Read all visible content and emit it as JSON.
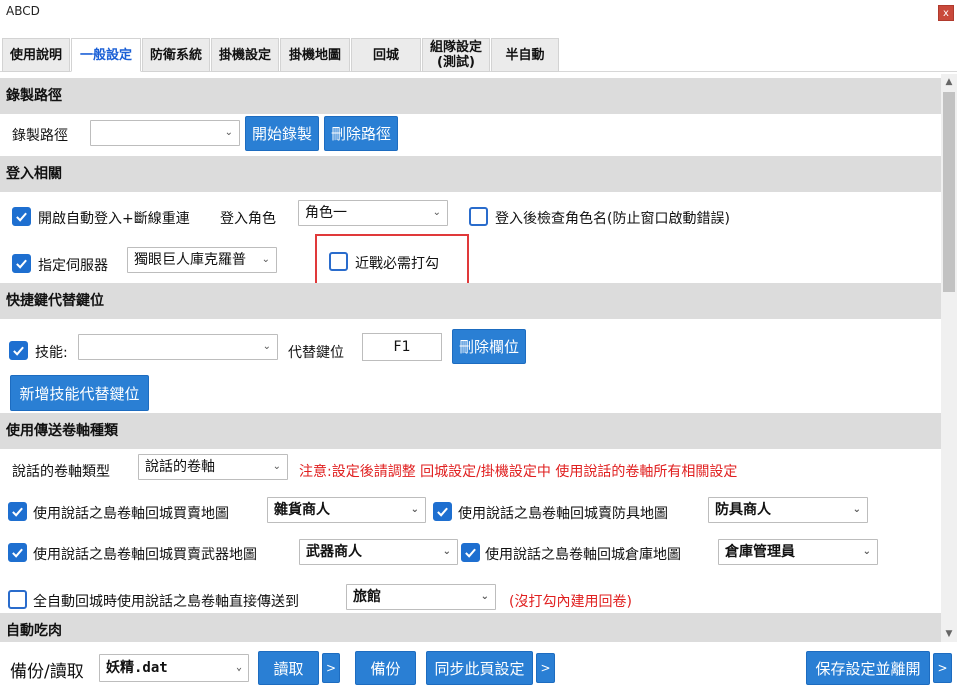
{
  "window": {
    "title": "ABCD",
    "close_label": "x"
  },
  "tabs": [
    {
      "label": "使用說明"
    },
    {
      "label": "一般設定"
    },
    {
      "label": "防衛系統"
    },
    {
      "label": "掛機設定"
    },
    {
      "label": "掛機地圖"
    },
    {
      "label": "回城"
    },
    {
      "label": "組隊設定\n(測試)"
    },
    {
      "label": "半自動"
    }
  ],
  "active_tab": "一般設定",
  "record": {
    "header": "錄製路徑",
    "label": "錄製路徑",
    "select_value": "",
    "start_button": "開始錄製",
    "delete_button": "刪除路徑"
  },
  "login": {
    "header": "登入相關",
    "auto_login_label": "開啟自動登入+斷線重連",
    "auto_login_checked": true,
    "role_label": "登入角色",
    "role_value": "角色一",
    "check_name_label": "登入後檢查角色名(防止窗口啟動錯誤)",
    "check_name_checked": false,
    "server_label": "指定伺服器",
    "server_checked": true,
    "server_value": "獨眼巨人庫克羅普",
    "melee_label": "近戰必需打勾",
    "melee_checked": false
  },
  "hotkey": {
    "header": "快捷鍵代替鍵位",
    "skill_label": "技能:",
    "skill_checked": true,
    "skill_value": "",
    "replace_label": "代替鍵位",
    "replace_value": "F1",
    "delete_button": "刪除欄位",
    "add_button": "新增技能代替鍵位"
  },
  "scroll": {
    "header": "使用傳送卷軸種類",
    "type_label": "說話的卷軸類型",
    "type_value": "說話的卷軸",
    "note": "注意:設定後請調整 回城設定/掛機設定中 使用說話的卷軸所有相關設定",
    "grocery_label": "使用說話之島卷軸回城買賣地圖",
    "grocery_checked": true,
    "grocery_value": "雜貨商人",
    "armor_label": "使用說話之島卷軸回城賣防具地圖",
    "armor_checked": true,
    "armor_value": "防具商人",
    "weapon_label": "使用說話之島卷軸回城買賣武器地圖",
    "weapon_checked": true,
    "weapon_value": "武器商人",
    "warehouse_label": "使用說話之島卷軸回城倉庫地圖",
    "warehouse_checked": true,
    "warehouse_value": "倉庫管理員",
    "auto_label": "全自動回城時使用說話之島卷軸直接傳送到",
    "auto_checked": false,
    "auto_value": "旅館",
    "auto_note": "(沒打勾內建用回卷)"
  },
  "auto_eat": {
    "header": "自動吃肉"
  },
  "footer": {
    "backup_label": "備份/讀取",
    "file_value": "妖精.dat",
    "read_button": "讀取",
    "arrow1": ">",
    "backup_button": "備份",
    "sync_button": "同步此頁設定",
    "arrow2": ">",
    "save_button": "保存設定並離開",
    "arrow3": ">"
  },
  "colors": {
    "accent": "#2a7fd4",
    "warning": "#e02020",
    "section_bg": "#dcdcdc",
    "active_tab_text": "#1a5fd6"
  },
  "icons": [
    "close-icon",
    "check-icon",
    "dropdown-caret-icon",
    "scroll-up-icon",
    "scroll-down-icon"
  ]
}
